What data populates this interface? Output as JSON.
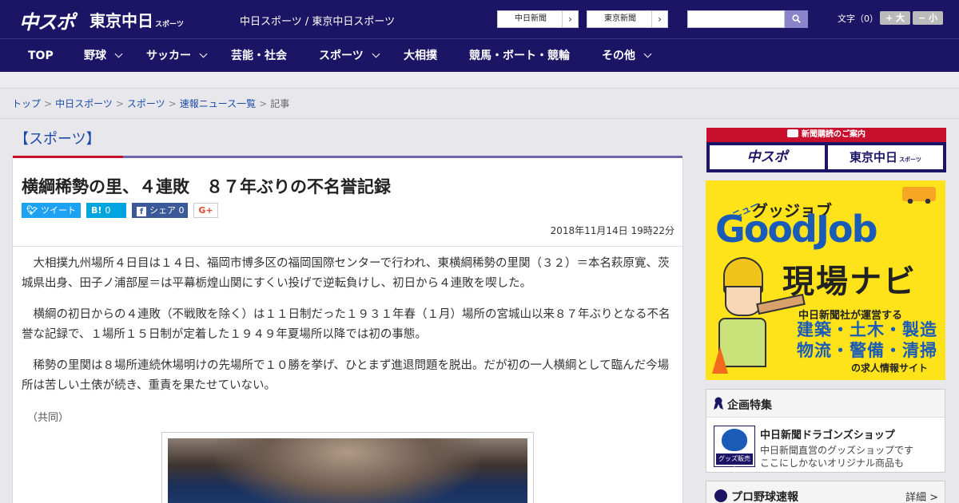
{
  "header": {
    "logo_main": "中スポ",
    "logo_sub": "東京中日",
    "logo_sub_small": "スポーツ",
    "site_links": "中日スポーツ / 東京中日スポーツ",
    "ext_buttons": [
      {
        "label": "中日新聞"
      },
      {
        "label": "東京新聞"
      }
    ],
    "search_placeholder": "",
    "fontsize_label": "文字（0）",
    "font_larger": "+ 大",
    "font_smaller": "− 小"
  },
  "nav": {
    "items": [
      {
        "label": "TOP",
        "dropdown": false
      },
      {
        "label": "野球",
        "dropdown": true
      },
      {
        "label": "サッカー",
        "dropdown": true
      },
      {
        "label": "芸能・社会",
        "dropdown": false
      },
      {
        "label": "スポーツ",
        "dropdown": true
      },
      {
        "label": "大相撲",
        "dropdown": false
      },
      {
        "label": "競馬・ボート・競輪",
        "dropdown": false
      },
      {
        "label": "その他",
        "dropdown": true
      }
    ]
  },
  "breadcrumb": {
    "items": [
      "トップ",
      "中日スポーツ",
      "スポーツ",
      "速報ニュース一覧"
    ],
    "current": "記事",
    "separator": ">"
  },
  "section": {
    "title": "【スポーツ】",
    "accent_red": "#c8102e",
    "accent_purple": "#6f64b0"
  },
  "article": {
    "headline": "横綱稀勢の里、４連敗　８７年ぶりの不名誉記録",
    "share": {
      "tweet_label": "ツイート",
      "hatena_label": "B!",
      "hatena_count": "0",
      "facebook_label": "シェア",
      "facebook_count": "0",
      "gplus_label": "G+"
    },
    "datetime": "2018年11月14日 19時22分",
    "paragraphs": [
      "大相撲九州場所４日目は１４日、福岡市博多区の福岡国際センターで行われ、東横綱稀勢の里関（３２）＝本名萩原寛、茨城県出身、田子ノ浦部屋＝は平幕栃煌山関にすくい投げで逆転負けし、初日から４連敗を喫した。",
      "横綱の初日からの４連敗（不戦敗を除く）は１１日制だった１９３１年春（１月）場所の宮城山以来８７年ぶりとなる不名誉な記録で、１場所１５日制が定着した１９４９年夏場所以降では初の事態。",
      "稀勢の里関は８場所連続休場明けの先場所で１０勝を挙げ、ひとまず進退問題を脱出。だが初の一人横綱として臨んだ今場所は苦しい土俵が続き、重責を果たせていない。"
    ],
    "credit": "（共同）"
  },
  "sidebar": {
    "promo_header": "新聞購読のご案内",
    "promo_tiles": [
      "中スポ",
      "東京中日"
    ],
    "promo_tile_small": "スポーツ",
    "goodjob": {
      "new_label": "ニュー",
      "kana": "グッジョブ",
      "logo": "GoodJob",
      "big": "現場ナビ",
      "sub": "中日新聞社が運営する",
      "jobs_line1": "建築・土木・製造",
      "jobs_line2": "物流・警備・清掃",
      "footer": "の求人情報サイト"
    },
    "feature": {
      "heading": "企画特集",
      "item_title": "中日新聞ドラゴンズショップ",
      "item_desc_1": "中日新聞直営のグッズショップです",
      "item_desc_2": "ここにしかないオリジナル商品も",
      "thumb_caption": "グッズ販売中"
    },
    "baseball": {
      "heading": "プロ野球速報",
      "more": "詳細 >"
    }
  },
  "colors": {
    "brand_navy": "#1c1464",
    "link_blue": "#1a4aa8",
    "twitter": "#1da1f2",
    "hatena": "#00a4de",
    "facebook": "#3b5998"
  }
}
